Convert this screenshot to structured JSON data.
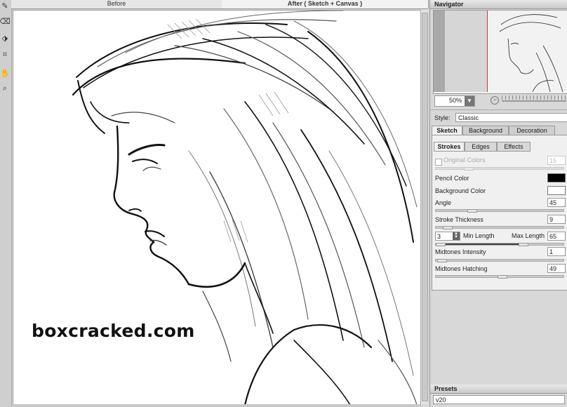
{
  "view_tabs": {
    "before": "Before",
    "after": "After ( Sketch + Canvas )"
  },
  "tools": [
    {
      "name": "pencil-icon",
      "glyph": "✎"
    },
    {
      "name": "eraser-icon",
      "glyph": "⌫"
    },
    {
      "name": "brush-icon",
      "glyph": "⬗"
    },
    {
      "name": "crop-icon",
      "glyph": "⌗"
    },
    {
      "name": "hand-icon",
      "glyph": "✋"
    },
    {
      "name": "zoom-icon",
      "glyph": "⌕"
    }
  ],
  "watermark": "boxcracked.com",
  "navigator": {
    "title": "Navigator",
    "zoom": "50%"
  },
  "style": {
    "label": "Style:",
    "value": "Classic"
  },
  "tabs": [
    "Sketch",
    "Background",
    "Decoration"
  ],
  "subtabs": [
    "Strokes",
    "Edges",
    "Effects"
  ],
  "settings": {
    "original_colors": {
      "label": "Original Colors",
      "value": "15",
      "checked": false
    },
    "pencil_color": {
      "label": "Pencil Color",
      "color": "#000000"
    },
    "background_color": {
      "label": "Background Color",
      "color": "#ffffff"
    },
    "angle": {
      "label": "Angle",
      "value": "45"
    },
    "stroke_thickness": {
      "label": "Stroke Thickness",
      "value": "9"
    },
    "min_length": {
      "label": "Min Length",
      "value": "3"
    },
    "max_length": {
      "label": "Max Length",
      "value": "65"
    },
    "midtones_intensity": {
      "label": "Midtones Intensity",
      "value": "1"
    },
    "midtones_hatching": {
      "label": "Midtones Hatching",
      "value": "49"
    }
  },
  "presets": {
    "title": "Presets",
    "value": "v20"
  }
}
